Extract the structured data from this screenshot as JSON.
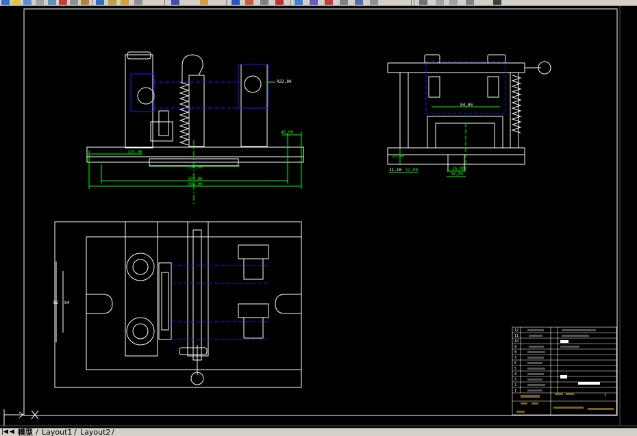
{
  "tabs": {
    "model": "模型",
    "layout1": "Layout1",
    "layout2": "Layout2"
  },
  "drawing": {
    "dims_front": {
      "d1": "125,00",
      "d2": "130,00",
      "d3": "254,00",
      "d4": "290,00",
      "d5": "46,00",
      "d6": "R22,00"
    },
    "dims_side": {
      "d1": "84,00",
      "d2": "20,00",
      "d3": "21,10",
      "d4": "12,00",
      "d5": "16,00",
      "d6": "36,00"
    },
    "dims_top": {
      "d1": "84",
      "d2": "B2"
    },
    "title_block": {
      "index": [
        "12",
        "11",
        "10",
        "9",
        "8",
        "7",
        "6",
        "5",
        "4",
        "3",
        "2",
        "1"
      ],
      "right_num": "1"
    }
  },
  "colors": {
    "white": "#ffffff",
    "blue": "#1c1cff",
    "green": "#00ff00",
    "cyan": "#00ffff",
    "yellow": "#ffff00",
    "ui_gray": "#d4d0c8"
  },
  "icons": [
    "ucs-icon",
    "toolbar-icons"
  ]
}
